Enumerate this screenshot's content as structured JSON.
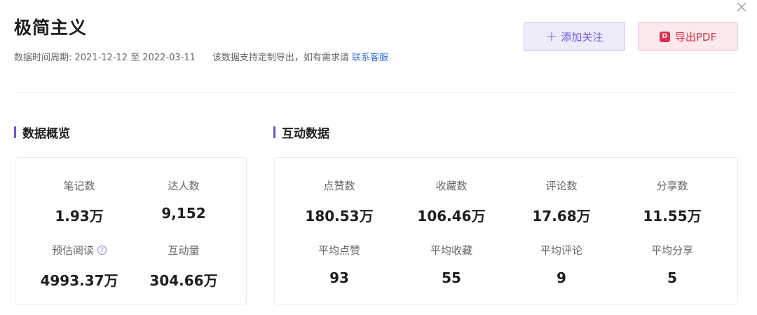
{
  "header": {
    "title": "极简主义",
    "period_label": "数据时间周期: 2021-12-12 至 2022-03-11",
    "note": "该数据支持定制导出，如有需求请",
    "contact_link": "联系客服"
  },
  "actions": {
    "follow_label": "添加关注",
    "export_label": "导出PDF",
    "pdf_icon_text": "D"
  },
  "overview": {
    "title": "数据概览",
    "items": [
      {
        "label": "笔记数",
        "value": "1.93万"
      },
      {
        "label": "达人数",
        "value": "9,152"
      },
      {
        "label": "预估阅读",
        "value": "4993.37万"
      },
      {
        "label": "互动量",
        "value": "304.66万"
      }
    ]
  },
  "interaction": {
    "title": "互动数据",
    "items": [
      {
        "label": "点赞数",
        "value": "180.53万"
      },
      {
        "label": "收藏数",
        "value": "106.46万"
      },
      {
        "label": "评论数",
        "value": "17.68万"
      },
      {
        "label": "分享数",
        "value": "11.55万"
      },
      {
        "label": "平均点赞",
        "value": "93"
      },
      {
        "label": "平均收藏",
        "value": "55"
      },
      {
        "label": "平均评论",
        "value": "9"
      },
      {
        "label": "平均分享",
        "value": "5"
      }
    ]
  },
  "colors": {
    "accent": "#6a55e0",
    "link": "#3b6fe0",
    "pdf": "#e0304a"
  }
}
